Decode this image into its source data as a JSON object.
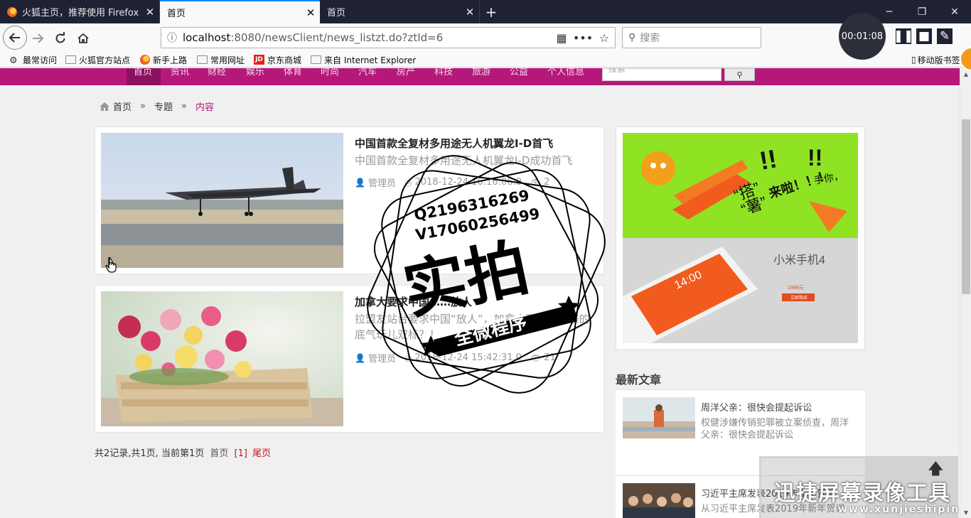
{
  "browser": {
    "tabs": [
      {
        "label": "火狐主页，推荐使用 Firefox 火狐浏览器",
        "close": "✕"
      },
      {
        "label": "首页",
        "close": "✕"
      },
      {
        "label": "首页",
        "close": "✕"
      }
    ],
    "new_tab": "+",
    "window_controls": {
      "minimize": "─",
      "restore": "❐",
      "close": "✕"
    },
    "url_host": "localhost",
    "url_path": ":8080/newsClient/news_listzt.do?ztId=6",
    "search_placeholder": "搜索",
    "bookmarks": [
      "最常访问",
      "火狐官方站点",
      "新手上路",
      "常用网址",
      "京东商城",
      "来自 Internet Explorer"
    ],
    "mobile_bookmarks": "移动版书签",
    "jd_icon_text": "JD",
    "icons": {
      "back": "arrow-left",
      "forward": "arrow-right",
      "reload": "reload",
      "home": "home",
      "info": "info",
      "qr": "qr-code",
      "more": "more",
      "star": "star",
      "search": "search"
    }
  },
  "recorder": {
    "time": "00:01:08",
    "pause": "❚❚",
    "stop": "■",
    "pen": "✎"
  },
  "site": {
    "nav": [
      "首页",
      "资讯",
      "财经",
      "娱乐",
      "体育",
      "时尚",
      "汽车",
      "房产",
      "科技",
      "旅游",
      "公益",
      "个人信息"
    ],
    "search_placeholder": "搜索",
    "search_icon": "🔍",
    "colors": {
      "brand": "#b5187a",
      "brand_dark": "#8e1060",
      "pager_link": "#c0161e"
    }
  },
  "breadcrumb": {
    "home": "首页",
    "sep": "»",
    "topic": "专题",
    "current": "内容"
  },
  "news": [
    {
      "title": "中国首款全复材多用途无人机翼龙I-D首飞",
      "summary": "中国首款全复材多用途无人机翼龙I-D成功首飞",
      "author": "管理员",
      "time": "2018-12-24 16:16:06.0",
      "views": "2"
    },
    {
      "title": "加拿大要求中国……放人",
      "summary": "拉盟友站台要求中国“放人”，加拿大政府哪儿来的底气玩儿双标？！",
      "author": "管理员",
      "time": "2018-12-24 15:42:31.0",
      "views": "21"
    }
  ],
  "pager": {
    "summary": "共2记录,共1页, 当前第1页",
    "first": "首页",
    "current": "[1]",
    "last": "尾页"
  },
  "ad": {
    "tag1": "“搭”",
    "tag2": "“薯”",
    "tag3": "来啦！！！",
    "tag4": "手你，",
    "phone": "小米手机4",
    "screen_time": "14:00",
    "price": "1999元",
    "buy": "立即购买"
  },
  "latest": {
    "title": "最新文章",
    "items": [
      {
        "title": "周洋父亲：很快会提起诉讼",
        "summary": "权健涉嫌传销犯罪被立案侦查，周洋父亲：很快会提起诉讼"
      },
      {
        "title": "习近平主席发表2019年新年贺词",
        "summary": "从习近平主席发表2019年新年贺词"
      }
    ]
  },
  "stamp": {
    "line1": "Q2196316269",
    "line2": "V17060256499",
    "big": "实拍",
    "banner": "全微程序"
  },
  "watermark": {
    "line1": "迅捷屏幕录像工具",
    "line2": "www.xunjieshipin.com"
  }
}
